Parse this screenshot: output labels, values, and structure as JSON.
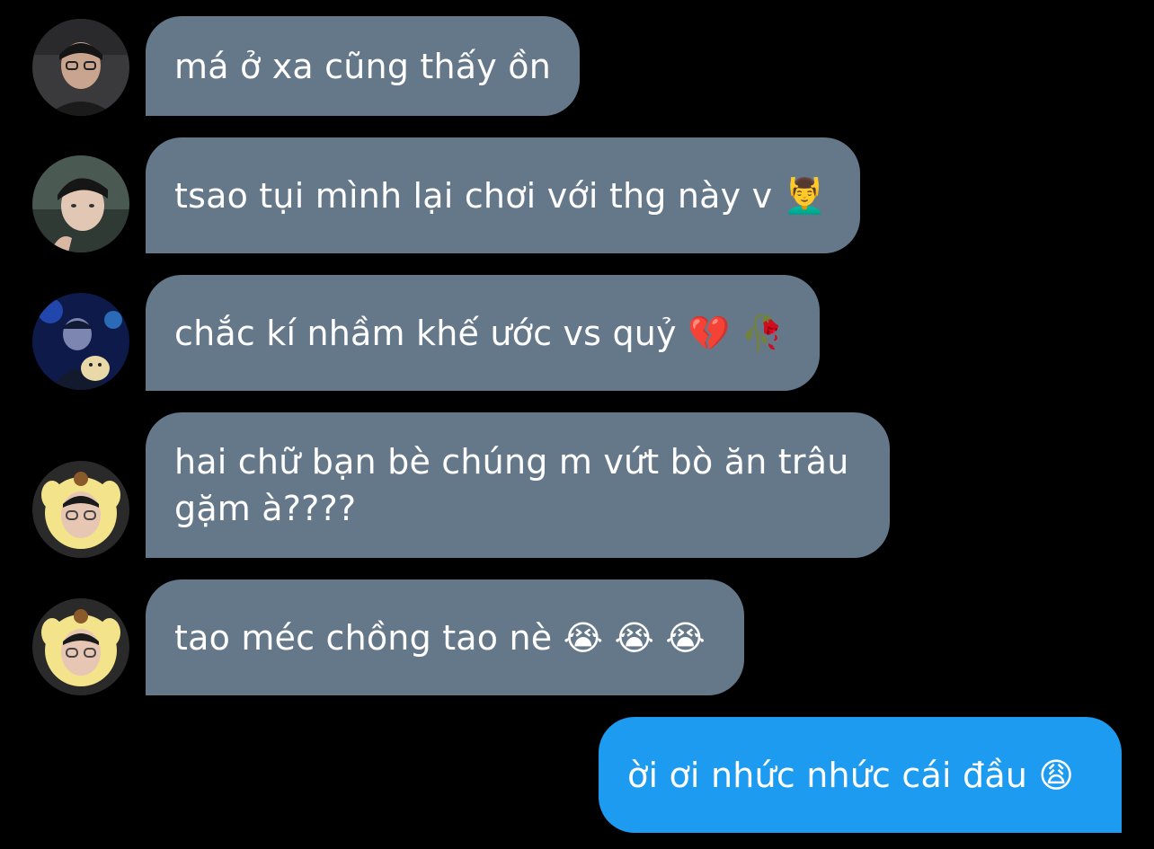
{
  "conversation": {
    "messages": [
      {
        "sender": "incoming",
        "text": "má ở xa cũng thấy ồn"
      },
      {
        "sender": "incoming",
        "text": "tsao tụi mình lại chơi với thg này v 💆‍♂️"
      },
      {
        "sender": "incoming",
        "text": "chắc kí nhầm khế ước vs quỷ 💔 🥀"
      },
      {
        "sender": "incoming",
        "text": "hai chữ bạn bè chúng m vứt bò ăn trâu\ngặm à????"
      },
      {
        "sender": "incoming",
        "text": "tao méc chồng tao nè 😭 😭 😭"
      },
      {
        "sender": "outgoing",
        "text": "ời ơi nhức nhức cái đầu 😩"
      }
    ]
  },
  "colors": {
    "background": "#000000",
    "incoming_bubble": "#65788a",
    "outgoing_bubble": "#1d9bf0",
    "text": "#ffffff"
  }
}
